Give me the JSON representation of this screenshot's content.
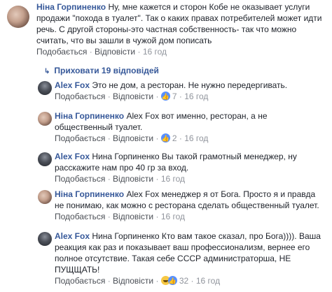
{
  "top_comment": {
    "author": "Ніна Горпиненко",
    "text": "Ну, мне кажется и сторон Кобе не оказывает услуги продажи \"похода в туалет\". Так о каких правах потребителей может идти речь. С другой стороны-это частная собственность- так что можно считать, что вы зашли в чужой дом пописать",
    "like_label": "Подобається",
    "reply_label": "Відповісти",
    "time": "16 год"
  },
  "hide_replies_label": "Приховати 19 відповідей",
  "replies": [
    {
      "author": "Alex Fox",
      "text": "Это не дом, а ресторан. Не нужно передергивать.",
      "like_label": "Подобається",
      "reply_label": "Відповісти",
      "reactions_icon": "like-reaction-icon",
      "reaction_count": "7",
      "time": "16 год"
    },
    {
      "author": "Ніна Горпиненко",
      "text": "Alex Fox вот именно, ресторан, а не общественный туалет.",
      "like_label": "Подобається",
      "reply_label": "Відповісти",
      "reactions_icon": "like-reaction-icon",
      "reaction_count": "2",
      "time": "16 год"
    },
    {
      "author": "Alex Fox",
      "text": "Нина Горпиненко Вы такой грамотный менеджер, ну расскажите нам про 40 гр за вход.",
      "like_label": "Подобається",
      "reply_label": "Відповісти",
      "time": "16 год"
    },
    {
      "author": "Ніна Горпиненко",
      "text": "Alex Fox менеджер я от Бога. Просто я и правда не понимаю, как можно с ресторана сделать общественный туалет.",
      "like_label": "Подобається",
      "reply_label": "Відповісти",
      "time": "16 год"
    },
    {
      "author": "Alex Fox",
      "text": "Нина Горпиненко Кто вам такое сказал, про Бога)))). Ваша реакция как раз и показывает ваш профессионализм, вернее его полное отсутствие. Такая себе СССР администраторша, НЕ ПУЩЩАТЬ!",
      "like_label": "Подобається",
      "reply_label": "Відповісти",
      "reactions_icon": "haha-reaction-icon",
      "reaction_count": "32",
      "time": "16 год"
    }
  ]
}
